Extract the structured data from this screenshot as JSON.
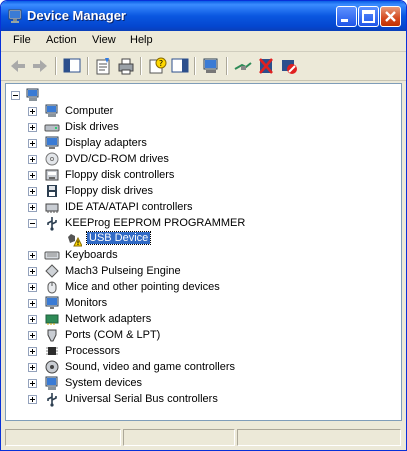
{
  "window": {
    "title": "Device Manager"
  },
  "menu": [
    "File",
    "Action",
    "View",
    "Help"
  ],
  "tree": {
    "root_expander": "−",
    "categories": [
      {
        "label": "Computer",
        "icon": "computer-icon",
        "expander": "+"
      },
      {
        "label": "Disk drives",
        "icon": "disk-drive-icon",
        "expander": "+"
      },
      {
        "label": "Display adapters",
        "icon": "display-adapter-icon",
        "expander": "+"
      },
      {
        "label": "DVD/CD-ROM drives",
        "icon": "cdrom-icon",
        "expander": "+"
      },
      {
        "label": "Floppy disk controllers",
        "icon": "floppy-controller-icon",
        "expander": "+"
      },
      {
        "label": "Floppy disk drives",
        "icon": "floppy-drive-icon",
        "expander": "+"
      },
      {
        "label": "IDE ATA/ATAPI controllers",
        "icon": "ide-controller-icon",
        "expander": "+"
      },
      {
        "label": "KEEProg EEPROM PROGRAMMER",
        "icon": "usb-icon",
        "expander": "−"
      },
      {
        "label": "USB Device",
        "icon": "warning-device-icon",
        "expander": ""
      },
      {
        "label": "Keyboards",
        "icon": "keyboard-icon",
        "expander": "+"
      },
      {
        "label": "Mach3 Pulseing Engine",
        "icon": "engine-icon",
        "expander": "+"
      },
      {
        "label": "Mice and other pointing devices",
        "icon": "mouse-icon",
        "expander": "+"
      },
      {
        "label": "Monitors",
        "icon": "monitor-icon",
        "expander": "+"
      },
      {
        "label": "Network adapters",
        "icon": "network-adapter-icon",
        "expander": "+"
      },
      {
        "label": "Ports (COM & LPT)",
        "icon": "port-icon",
        "expander": "+"
      },
      {
        "label": "Processors",
        "icon": "processor-icon",
        "expander": "+"
      },
      {
        "label": "Sound, video and game controllers",
        "icon": "sound-icon",
        "expander": "+"
      },
      {
        "label": "System devices",
        "icon": "system-device-icon",
        "expander": "+"
      },
      {
        "label": "Universal Serial Bus controllers",
        "icon": "usb-controller-icon",
        "expander": "+"
      }
    ]
  },
  "colors": {
    "selection": "#316ac5",
    "titlebar": "#0a5ee6",
    "warning": "#ffd800"
  }
}
